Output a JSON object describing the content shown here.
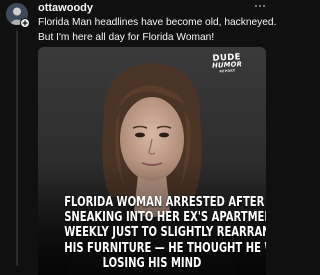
{
  "post": {
    "username": "ottawoody",
    "verified": false,
    "caption_lines": [
      "Florida Man headlines have become old, hackneyed.",
      "But I'm here all day for Florida Woman!"
    ],
    "more_icon": "more-horizontal-icon",
    "follow_icon": "plus-icon"
  },
  "media": {
    "logo": {
      "line1": "DUDE",
      "line2": "HUMOR",
      "line3": "REPORT"
    },
    "headline_lines": [
      "FLORIDA WOMAN ARRESTED AFTER",
      "SNEAKING INTO HER EX'S APARTMENT",
      "WEEKLY JUST TO SLIGHTLY REARRANGE",
      "HIS FURNITURE — HE THOUGHT HE WAS",
      "LOSING HIS MIND"
    ]
  },
  "colors": {
    "background": "#101010",
    "text_primary": "#f3f5f7",
    "text_secondary": "#9a9a9a",
    "thread_line": "#2b2b2b",
    "headline": "#ffffff"
  }
}
